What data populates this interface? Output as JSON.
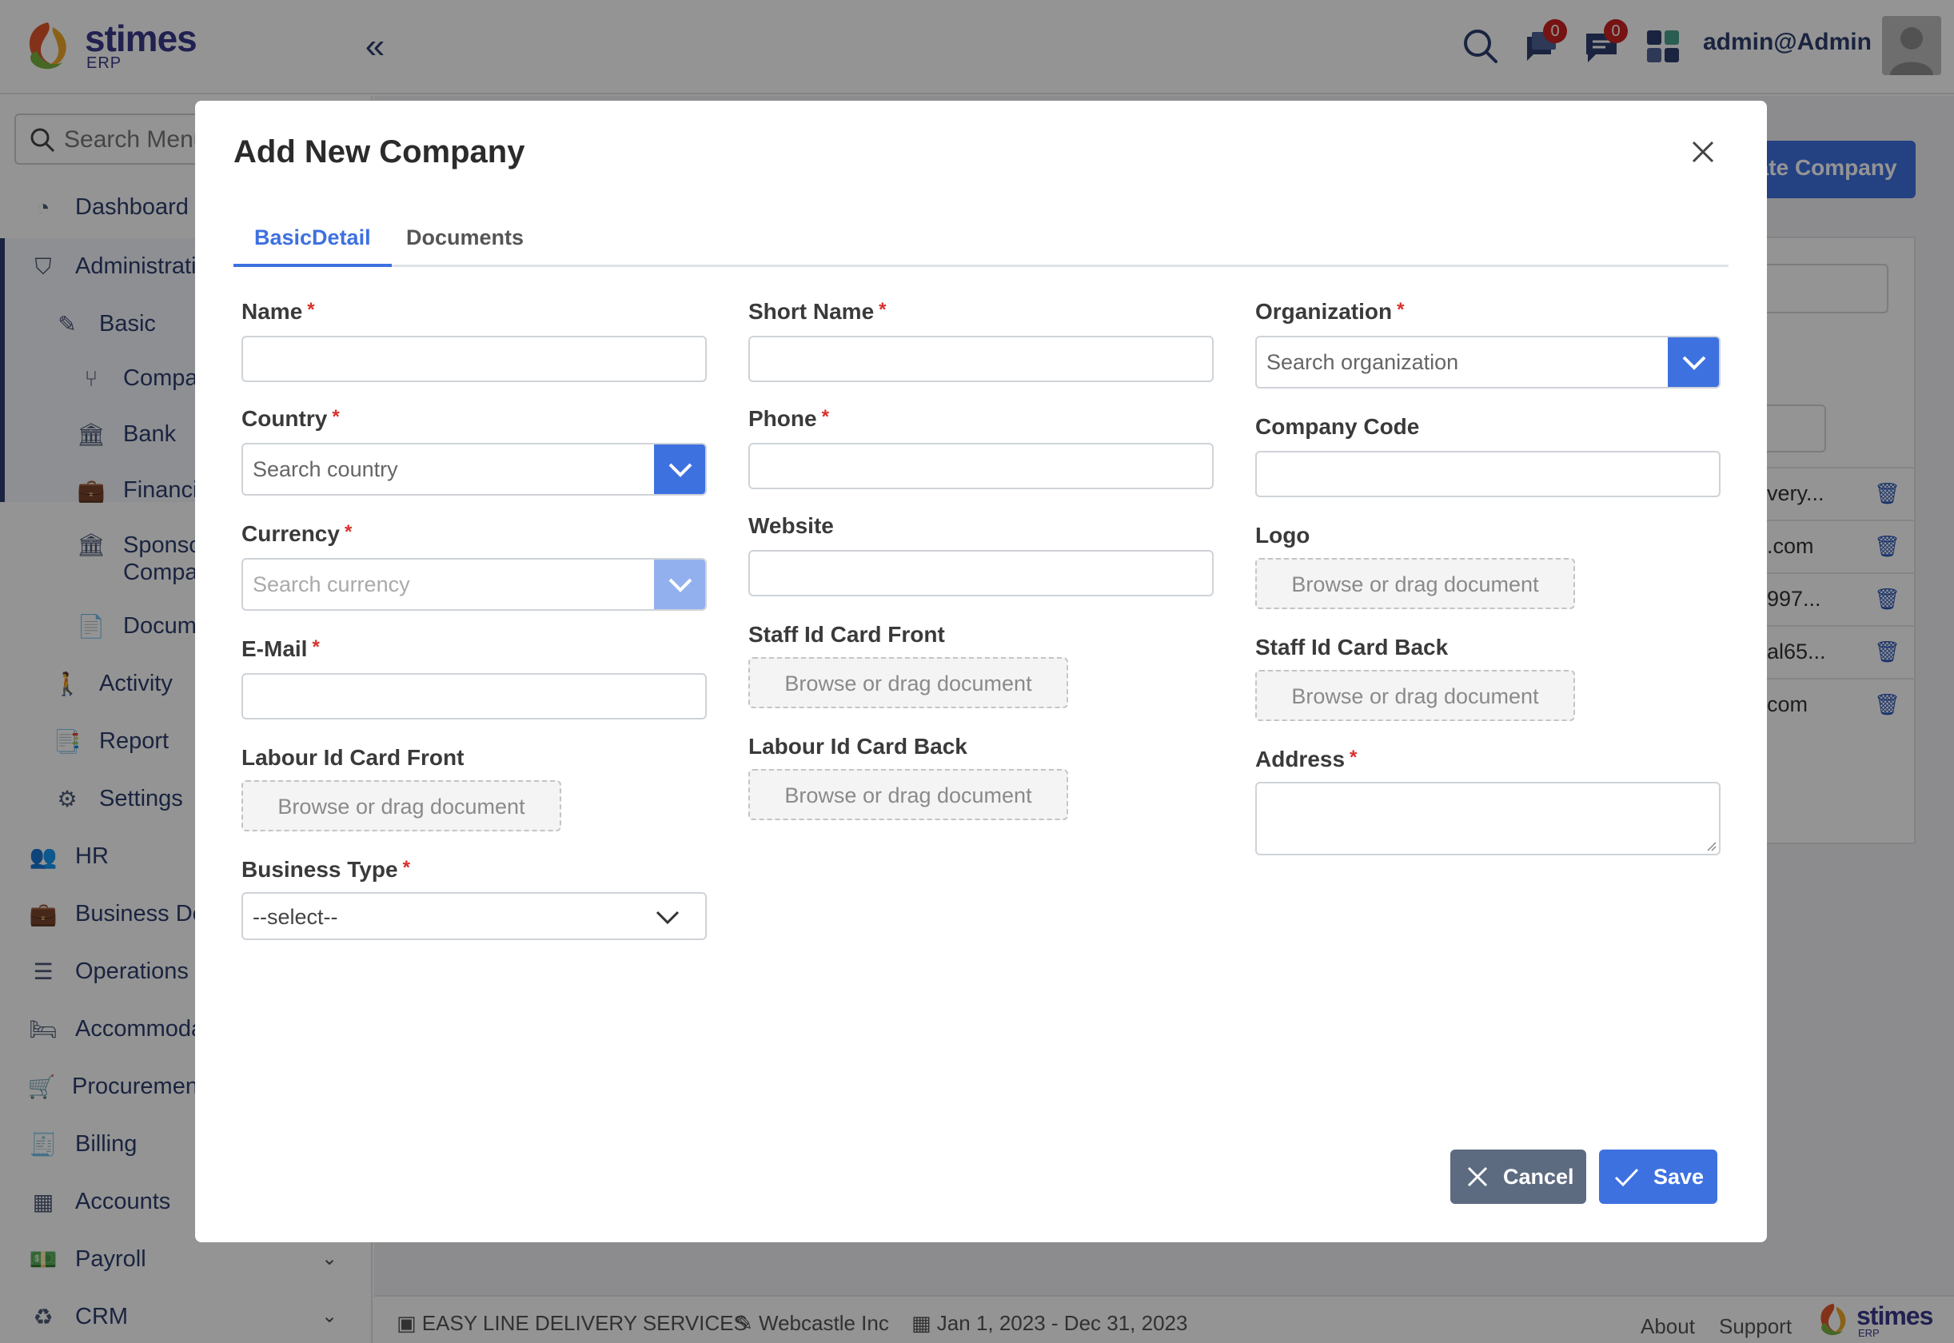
{
  "app": {
    "logo_text": "stimes",
    "logo_sub": "ERP",
    "user": "admin@Admin",
    "notification_count": "0",
    "message_count": "0"
  },
  "sidebar": {
    "search_placeholder": "Search Menu",
    "items": [
      {
        "label": "Dashboard",
        "icon": "dashboard-icon"
      },
      {
        "label": "Administration",
        "icon": "admin-icon"
      },
      {
        "label": "Basic",
        "icon": "pin-icon"
      },
      {
        "label": "Company",
        "icon": "branch-icon"
      },
      {
        "label": "Bank",
        "icon": "bank-icon"
      },
      {
        "label": "Financial",
        "icon": "finance-icon"
      },
      {
        "label": "Sponsor Company",
        "icon": "bank-icon"
      },
      {
        "label": "Documents",
        "icon": "document-icon"
      },
      {
        "label": "Activity",
        "icon": "walk-icon"
      },
      {
        "label": "Report",
        "icon": "pdf-icon"
      },
      {
        "label": "Settings",
        "icon": "gear-icon"
      },
      {
        "label": "HR",
        "icon": "hr-icon"
      },
      {
        "label": "Business Development",
        "icon": "briefcase-icon"
      },
      {
        "label": "Operations",
        "icon": "sliders-icon"
      },
      {
        "label": "Accommodation",
        "icon": "bed-icon"
      },
      {
        "label": "Procurement",
        "icon": "cart-icon"
      },
      {
        "label": "Billing",
        "icon": "invoice-icon"
      },
      {
        "label": "Accounts",
        "icon": "excel-icon"
      },
      {
        "label": "Payroll",
        "icon": "money-icon"
      },
      {
        "label": "CRM",
        "icon": "recycle-icon"
      }
    ]
  },
  "background": {
    "create_button": "Create Company",
    "rows": [
      "very...",
      ".com",
      "997...",
      "al65...",
      "com"
    ]
  },
  "footer": {
    "company": "EASY LINE DELIVERY SERVICES",
    "org": "Webcastle Inc",
    "period": "Jan 1, 2023 - Dec 31, 2023",
    "about": "About",
    "support": "Support"
  },
  "modal": {
    "title": "Add New Company",
    "tabs": [
      "BasicDetail",
      "Documents"
    ],
    "active_tab": "BasicDetail",
    "fields": {
      "name": {
        "label": "Name",
        "required": true,
        "value": ""
      },
      "short_name": {
        "label": "Short Name",
        "required": true,
        "value": ""
      },
      "organization": {
        "label": "Organization",
        "required": true,
        "placeholder": "Search organization"
      },
      "country": {
        "label": "Country",
        "required": true,
        "placeholder": "Search country"
      },
      "phone": {
        "label": "Phone",
        "required": true,
        "value": ""
      },
      "company_code": {
        "label": "Company Code",
        "required": false,
        "value": ""
      },
      "currency": {
        "label": "Currency",
        "required": true,
        "placeholder": "Search currency"
      },
      "website": {
        "label": "Website",
        "required": false,
        "value": ""
      },
      "logo": {
        "label": "Logo",
        "dropzone": "Browse or drag document"
      },
      "email": {
        "label": "E-Mail",
        "required": true,
        "value": ""
      },
      "staff_front": {
        "label": "Staff Id Card Front",
        "dropzone": "Browse or drag document"
      },
      "staff_back": {
        "label": "Staff Id Card Back",
        "dropzone": "Browse or drag document"
      },
      "labour_front": {
        "label": "Labour Id Card Front",
        "dropzone": "Browse or drag document"
      },
      "labour_back": {
        "label": "Labour Id Card Back",
        "dropzone": "Browse or drag document"
      },
      "address": {
        "label": "Address",
        "required": true,
        "value": ""
      },
      "business_type": {
        "label": "Business Type",
        "required": true,
        "selected": "--select--"
      }
    },
    "buttons": {
      "cancel": "Cancel",
      "save": "Save"
    }
  },
  "colors": {
    "primary": "#3e71e0",
    "primary_disabled": "#93b0ee",
    "cancel": "#5d6b81",
    "required": "#d9302c",
    "nav_text": "#2e3f6e"
  }
}
